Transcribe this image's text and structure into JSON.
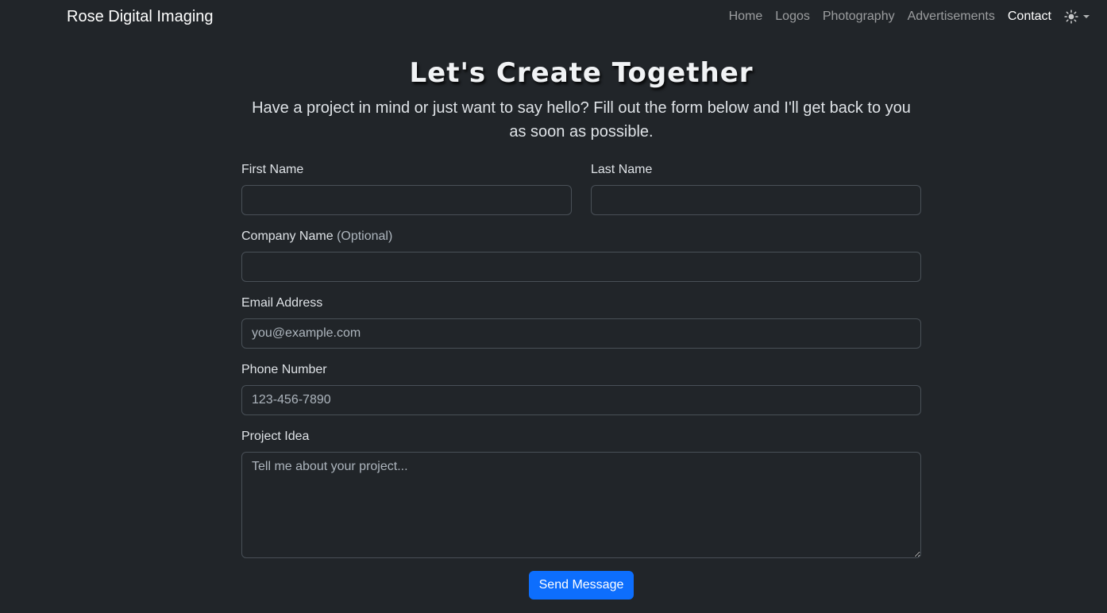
{
  "navbar": {
    "brand": "Rose Digital Imaging",
    "links": [
      {
        "label": "Home",
        "active": false
      },
      {
        "label": "Logos",
        "active": false
      },
      {
        "label": "Photography",
        "active": false
      },
      {
        "label": "Advertisements",
        "active": false
      },
      {
        "label": "Contact",
        "active": true
      }
    ],
    "theme_icon": "sun-icon"
  },
  "hero": {
    "title": "Let's Create Together",
    "subtitle": "Have a project in mind or just want to say hello? Fill out the form below and I'll get back to you as soon as possible."
  },
  "form": {
    "first_name": {
      "label": "First Name",
      "value": "",
      "placeholder": ""
    },
    "last_name": {
      "label": "Last Name",
      "value": "",
      "placeholder": ""
    },
    "company": {
      "label": "Company Name",
      "optional": "(Optional)",
      "value": "",
      "placeholder": ""
    },
    "email": {
      "label": "Email Address",
      "value": "",
      "placeholder": "you@example.com"
    },
    "phone": {
      "label": "Phone Number",
      "value": "",
      "placeholder": "123-456-7890"
    },
    "project": {
      "label": "Project Idea",
      "value": "",
      "placeholder": "Tell me about your project..."
    },
    "submit_label": "Send Message"
  },
  "colors": {
    "background": "#212529",
    "primary": "#0d6efd",
    "border": "#495057"
  }
}
